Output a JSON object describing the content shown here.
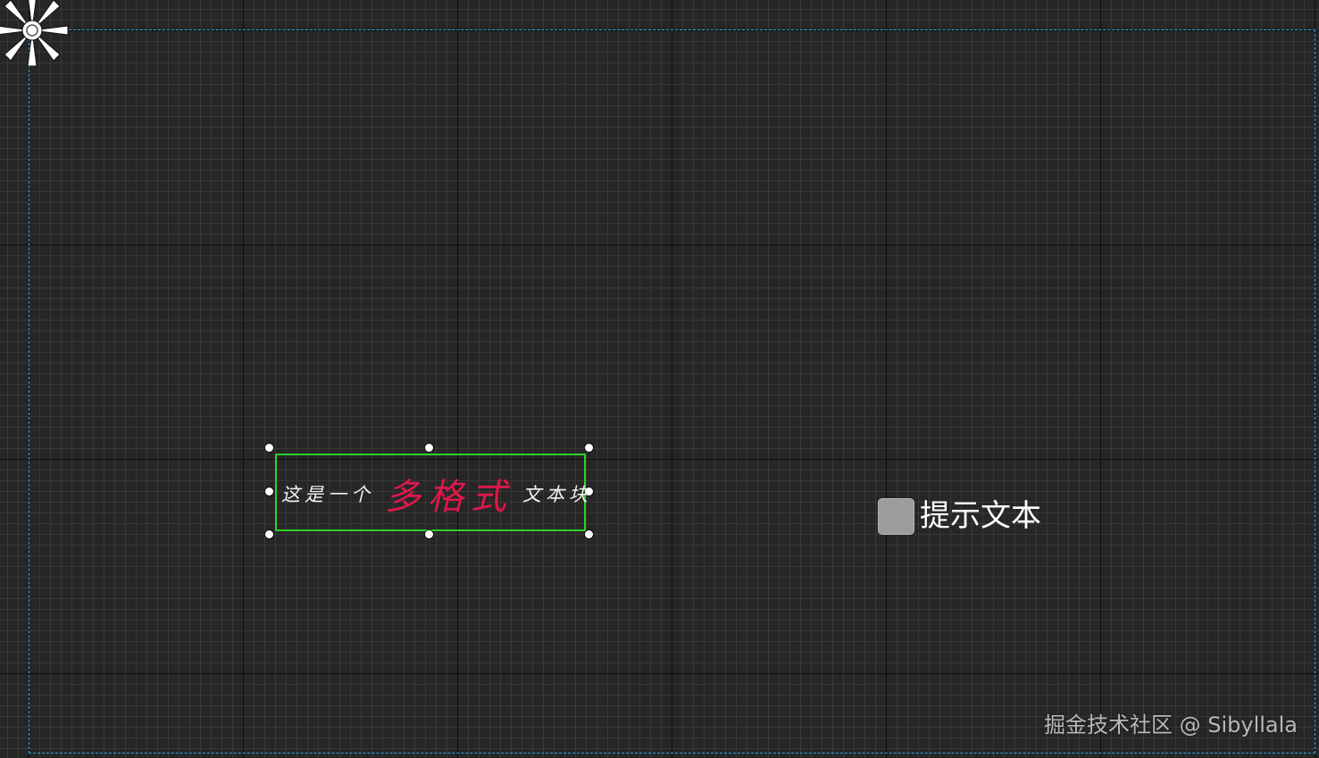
{
  "canvas": {
    "grid": true,
    "bounds_color": "#2aa7dd",
    "background": "#262626"
  },
  "pivot": {
    "icon": "pivot-gear-icon"
  },
  "text_block": {
    "prefix": "这是一个",
    "emphasis": "多格式",
    "suffix": "文本块",
    "emphasis_color": "#e0174a",
    "selection_color": "#2bd12b"
  },
  "hint": {
    "icon": "image-placeholder-icon",
    "label": "提示文本"
  },
  "watermark": {
    "text": "掘金技术社区 @ Sibyllala"
  }
}
